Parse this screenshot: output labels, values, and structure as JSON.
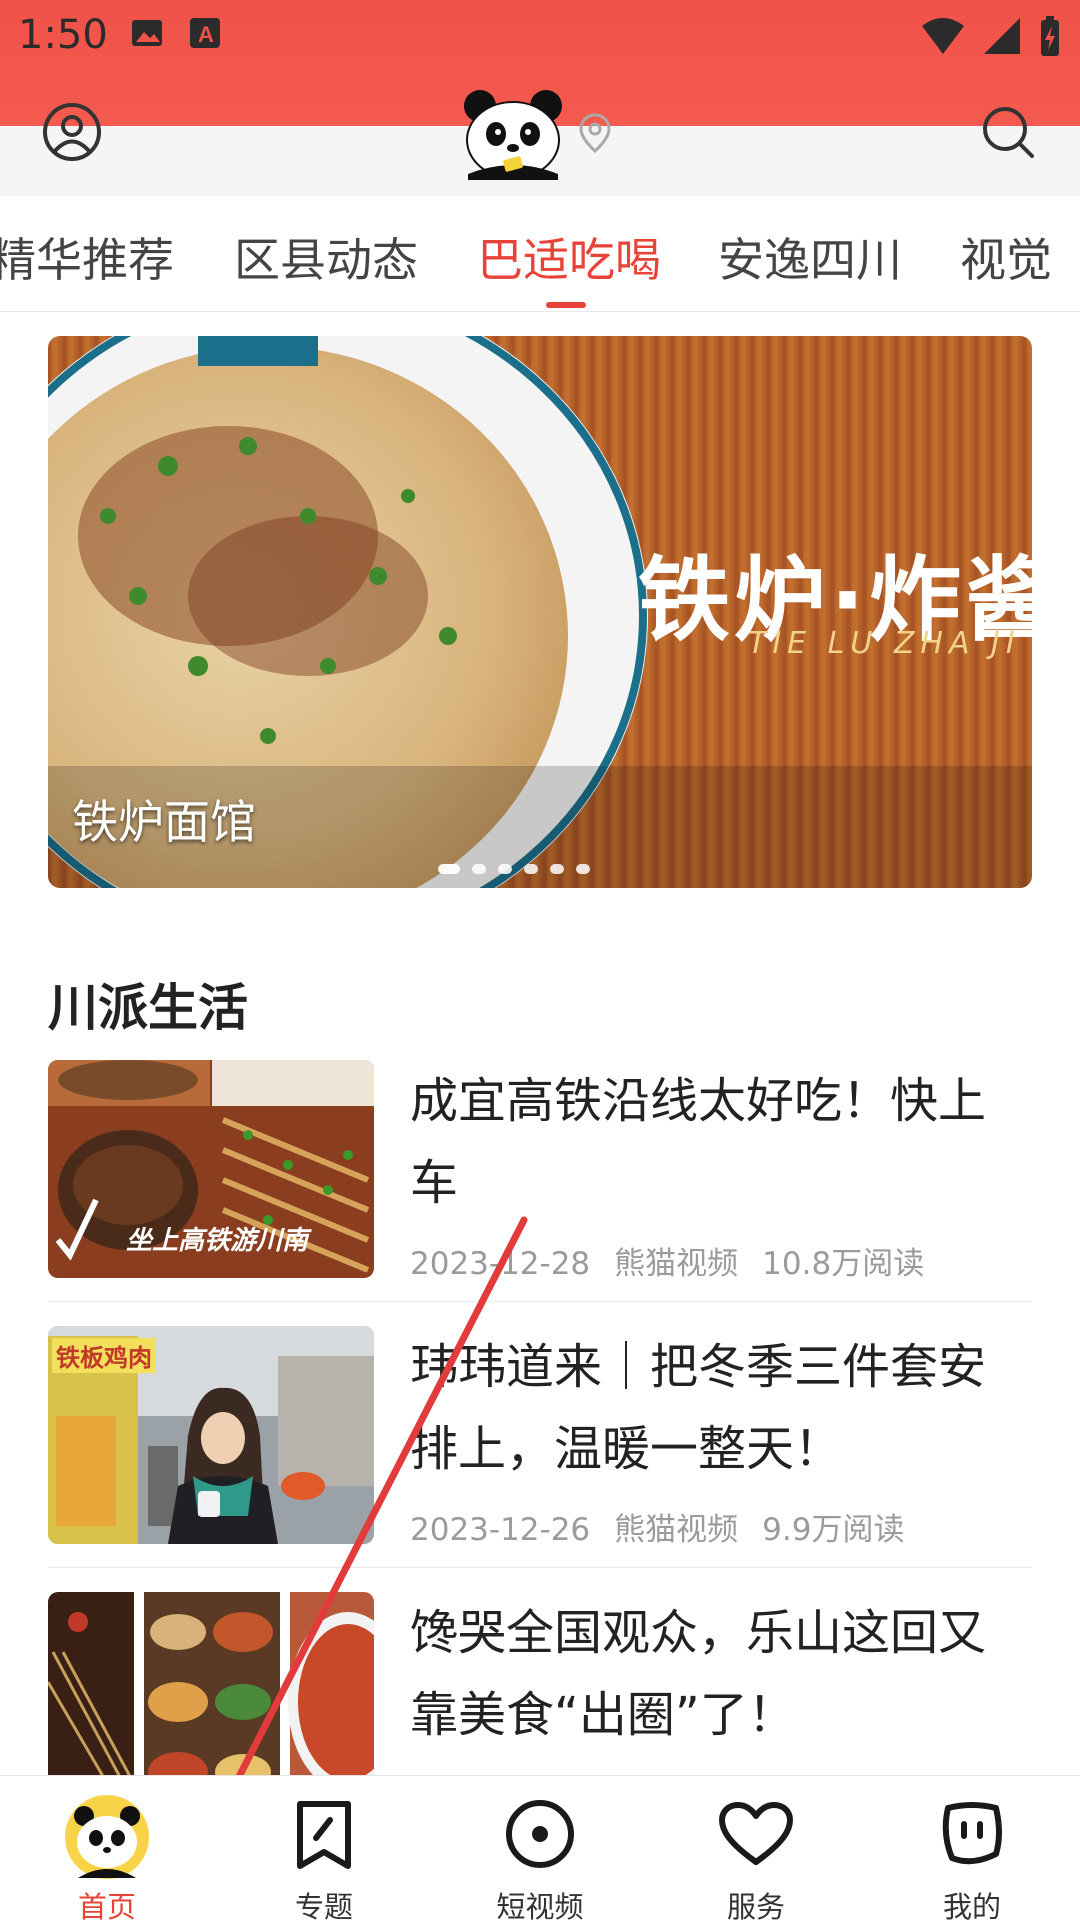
{
  "status_bar": {
    "time": "1:50"
  },
  "header": {
    "logo_icon": "panda-logo",
    "location_icon": "location-pin-icon"
  },
  "tabs": [
    {
      "label": "精华推荐"
    },
    {
      "label": "区县动态"
    },
    {
      "label": "巴适吃喝"
    },
    {
      "label": "安逸四川"
    },
    {
      "label": "视觉"
    }
  ],
  "active_tab": "巴适吃喝",
  "banner": {
    "caption": "铁炉面馆",
    "overlay_title": "铁炉·炸酱",
    "overlay_subtitle": "TIE LU ZHA JI",
    "dot_count": 7,
    "active_dot": 1
  },
  "section": {
    "title": "川派生活"
  },
  "news": [
    {
      "title": "成宜高铁沿线太好吃！快上车",
      "date": "2023-12-28",
      "source": "熊猫视频",
      "reads": "10.8万阅读",
      "thumb_text": "坐上高铁游川南"
    },
    {
      "title": "玮玮道来｜把冬季三件套安排上，温暖一整天！",
      "date": "2023-12-26",
      "source": "熊猫视频",
      "reads": "9.9万阅读",
      "thumb_text": "铁板鸡肉"
    },
    {
      "title": "馋哭全国观众，乐山这回又靠美食“出圈”了！",
      "date": "",
      "source": "",
      "reads": ""
    }
  ],
  "bottom_nav": [
    {
      "label": "首页",
      "icon": "panda-home-icon",
      "active": true
    },
    {
      "label": "专题",
      "icon": "bookmark-icon",
      "active": false
    },
    {
      "label": "短视频",
      "icon": "video-circle-icon",
      "active": false
    },
    {
      "label": "服务",
      "icon": "heart-icon",
      "active": false
    },
    {
      "label": "我的",
      "icon": "profile-face-icon",
      "active": false
    }
  ],
  "colors": {
    "accent": "#e84339",
    "status_bar": "#f0544a",
    "text": "#222222",
    "meta": "#9b9b9b"
  }
}
